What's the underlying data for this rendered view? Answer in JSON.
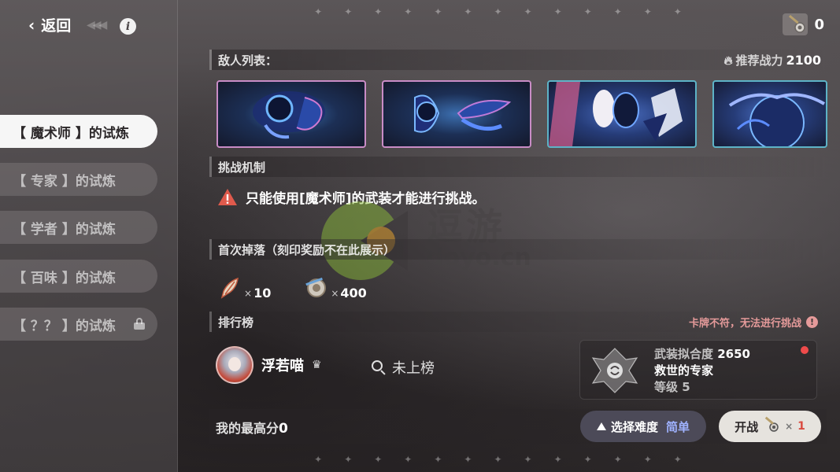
{
  "nav": {
    "back_label": "返回",
    "info_icon": "info-icon",
    "trials": [
      {
        "label": "【 魔术师 】的试炼",
        "active": true,
        "locked": false
      },
      {
        "label": "【 专家 】的试炼",
        "active": false,
        "locked": false
      },
      {
        "label": "【 学者 】的试炼",
        "active": false,
        "locked": false
      },
      {
        "label": "【 百味 】的试炼",
        "active": false,
        "locked": false
      },
      {
        "label": "【 ？？ 】的试炼",
        "active": false,
        "locked": true
      }
    ]
  },
  "header": {
    "currency_icon": "key-icon",
    "currency_count": "0"
  },
  "enemies": {
    "title": "敌人列表：",
    "power_label": "推荐战力",
    "power_value": "2100",
    "cards": [
      {
        "name": "enemy-1",
        "frame": "pink"
      },
      {
        "name": "enemy-2",
        "frame": "pink"
      },
      {
        "name": "enemy-3",
        "frame": "teal"
      },
      {
        "name": "enemy-4",
        "frame": "teal"
      }
    ]
  },
  "mechanism": {
    "title": "挑战机制",
    "warning": "只能使用[魔术师]的武装才能进行挑战。"
  },
  "drops": {
    "title": "首次掉落（刻印奖励不在此展示）",
    "items": [
      {
        "icon": "feather-quill-icon",
        "x": "×",
        "count": "10"
      },
      {
        "icon": "gear-coin-icon",
        "x": "×",
        "count": "400"
      }
    ]
  },
  "leaderboard": {
    "title": "排行榜",
    "warning": "卡牌不符，无法进行挑战",
    "player_name": "浮若喵",
    "rank_status": "未上榜"
  },
  "loadout": {
    "fit_label": "武装拟合度",
    "fit_value": "2650",
    "name": "救世的专家",
    "level": "等级 5"
  },
  "footer": {
    "best_label": "我的最高分",
    "best_value": "0",
    "difficulty_label": "选择难度",
    "difficulty_value": "简单",
    "start_label": "开战",
    "start_cost_x": "×",
    "start_cost": "1"
  },
  "watermark": {
    "text": "逗游",
    "url": "doyo.cn"
  },
  "colors": {
    "active_tab_bg": "#f6f6f6",
    "enemy_frame_pink": "#c98cc6",
    "enemy_frame_teal": "#5db3c7",
    "warning_red": "#e05a4c",
    "difficulty_blue": "#9fb2ff",
    "start_cost_red": "#d94a3f",
    "notice_dot": "#ef4b4b"
  }
}
